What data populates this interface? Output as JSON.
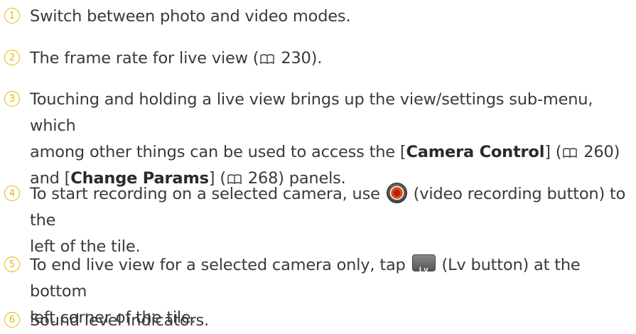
{
  "items": [
    {
      "num": "1",
      "text": "Switch between photo and video modes."
    },
    {
      "num": "2",
      "t1": "The frame rate for live view (",
      "t2": " 230)."
    },
    {
      "num": "3",
      "t1": "Touching and holding a live view brings up the view/settings sub-menu, which",
      "t2": "among other things can be used to access the [",
      "b1": "Camera Control",
      "t3": "] (",
      "t4": " 260)",
      "t5": "and [",
      "b2": "Change Params",
      "t6": "] (",
      "t7": " 268) panels."
    },
    {
      "num": "4",
      "t1": "To start recording on a selected camera, use ",
      "t2": " (video recording button) to the",
      "t3": "left of the tile."
    },
    {
      "num": "5",
      "t1": "To end live view for a selected camera only, tap ",
      "t2": " (Lv button) at the bottom",
      "t3": "left corner of the tile."
    },
    {
      "num": "6",
      "text": "Sound level indicators."
    }
  ],
  "colors": {
    "number_circle": "#e8b400",
    "text": "#3a3a3a",
    "record_button": "#e3480f"
  },
  "icons": {
    "manual_reference": "book-icon",
    "record": "video-recording-button-icon",
    "lv": "lv-button-icon"
  }
}
